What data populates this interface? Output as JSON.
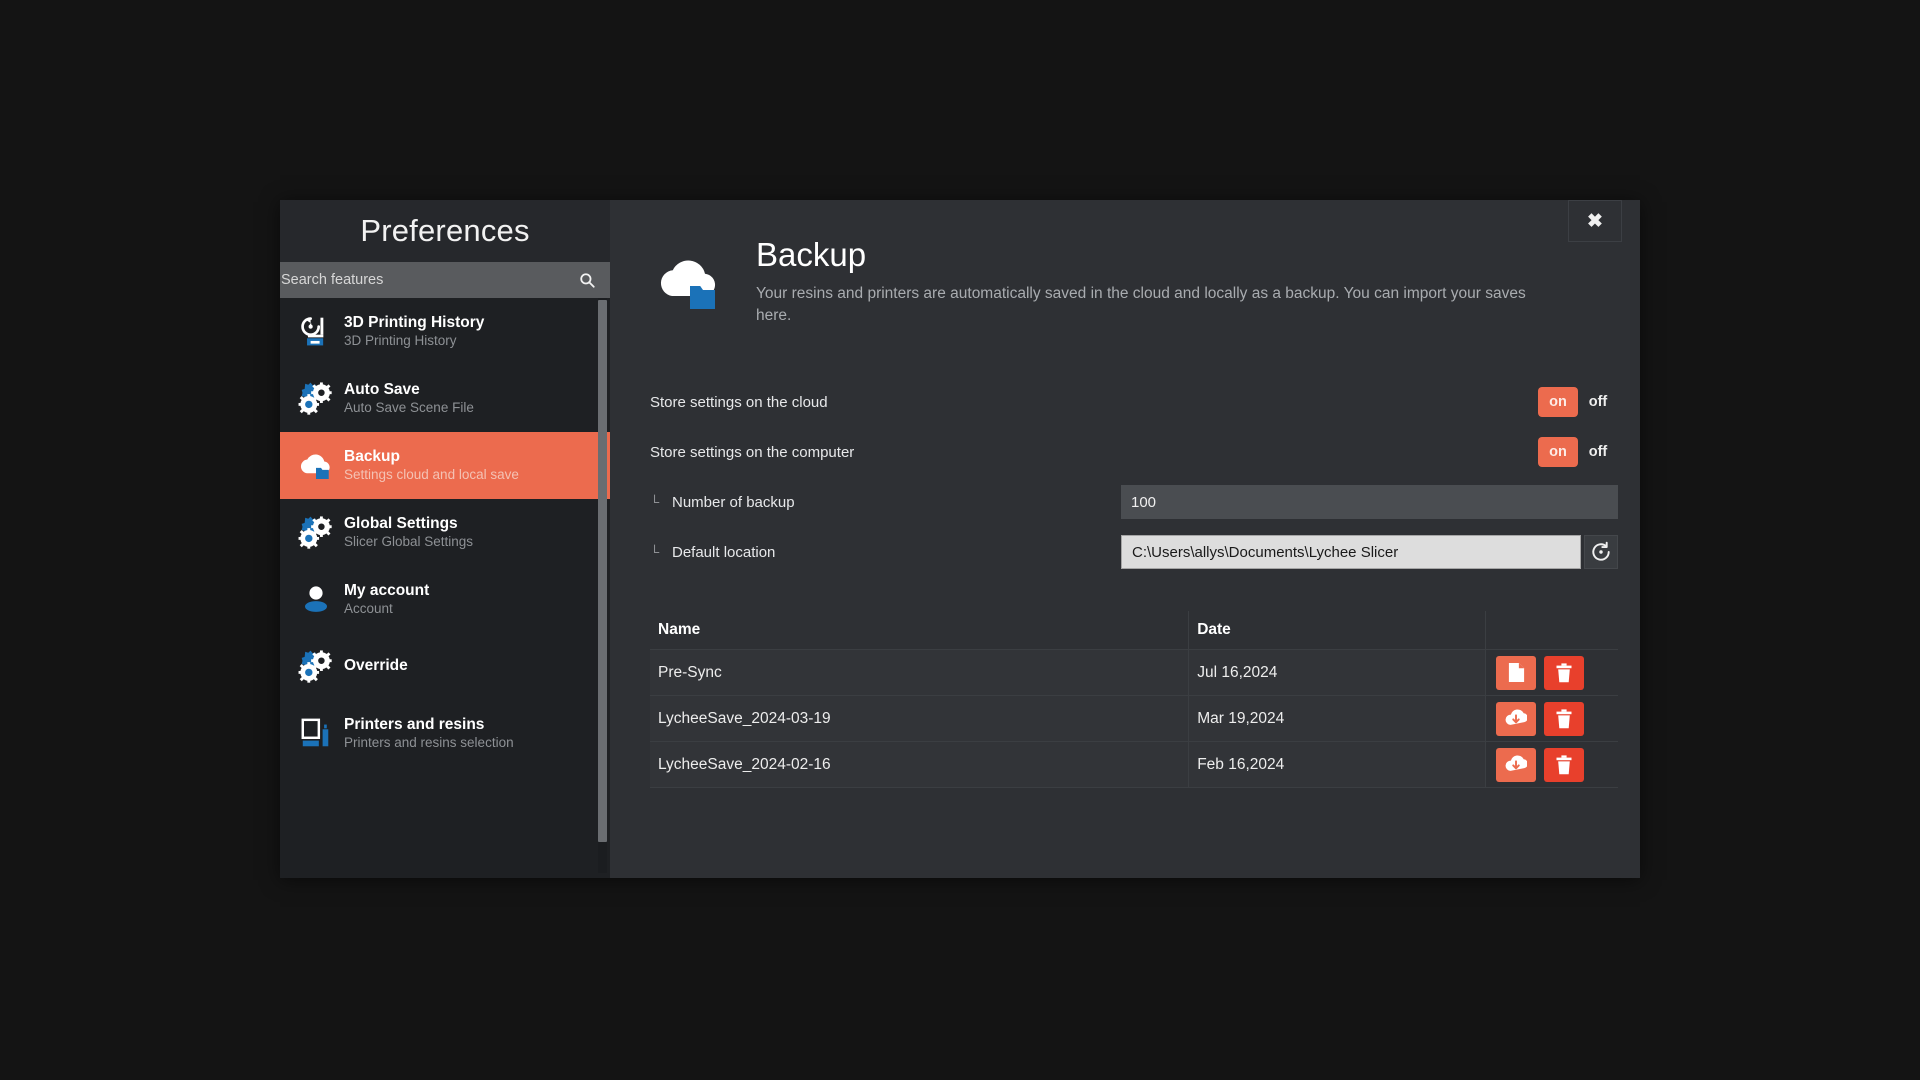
{
  "dialog": {
    "title": "Preferences",
    "close_label": "✖"
  },
  "search": {
    "placeholder": "Search features",
    "value": "",
    "icon": "search-icon"
  },
  "sidebar": {
    "items": [
      {
        "label": "3D Printing History",
        "sub": "3D Printing History",
        "icon": "history-printer-icon",
        "selected": false
      },
      {
        "label": "Auto Save",
        "sub": "Auto Save Scene File",
        "icon": "gears-icon",
        "selected": false
      },
      {
        "label": "Backup",
        "sub": "Settings cloud and local save",
        "icon": "cloud-folder-icon",
        "selected": true
      },
      {
        "label": "Global Settings",
        "sub": "Slicer Global Settings",
        "icon": "gears-icon",
        "selected": false
      },
      {
        "label": "My account",
        "sub": "Account",
        "icon": "user-icon",
        "selected": false
      },
      {
        "label": "Override",
        "sub": "",
        "icon": "gears-icon",
        "selected": false
      },
      {
        "label": "Printers and resins",
        "sub": "Printers and resins selection",
        "icon": "printer-resin-icon",
        "selected": false
      }
    ]
  },
  "content": {
    "icon": "cloud-folder-icon",
    "title": "Backup",
    "description": "Your resins and printers are automatically saved in the cloud and locally as a backup. You can import your saves here.",
    "settings": {
      "store_cloud": {
        "label": "Store settings on the cloud",
        "on_label": "on",
        "off_label": "off",
        "value": "on"
      },
      "store_computer": {
        "label": "Store settings on the computer",
        "on_label": "on",
        "off_label": "off",
        "value": "on"
      },
      "number_of_backup": {
        "label": "Number of backup",
        "value": "100",
        "tree_mark": "└"
      },
      "default_location": {
        "label": "Default location",
        "value": "C:\\Users\\allys\\Documents\\Lychee Slicer",
        "tree_mark": "└",
        "reset_icon": "reset-circular-arrow-icon"
      }
    },
    "table": {
      "columns": [
        "Name",
        "Date",
        ""
      ],
      "rows": [
        {
          "name": "Pre-Sync",
          "date": "Jul 16,2024",
          "primary_icon": "file-document-icon",
          "delete_icon": "trash-icon"
        },
        {
          "name": "LycheeSave_2024-03-19",
          "date": "Mar 19,2024",
          "primary_icon": "cloud-download-icon",
          "delete_icon": "trash-icon"
        },
        {
          "name": "LycheeSave_2024-02-16",
          "date": "Feb 16,2024",
          "primary_icon": "cloud-download-icon",
          "delete_icon": "trash-icon"
        }
      ]
    }
  },
  "colors": {
    "accent_orange": "#ec6b4e",
    "delete_red": "#e8402c",
    "icon_blue": "#1b72b8",
    "panel_bg": "#2e3034",
    "sidebar_bg": "#1e2023"
  }
}
